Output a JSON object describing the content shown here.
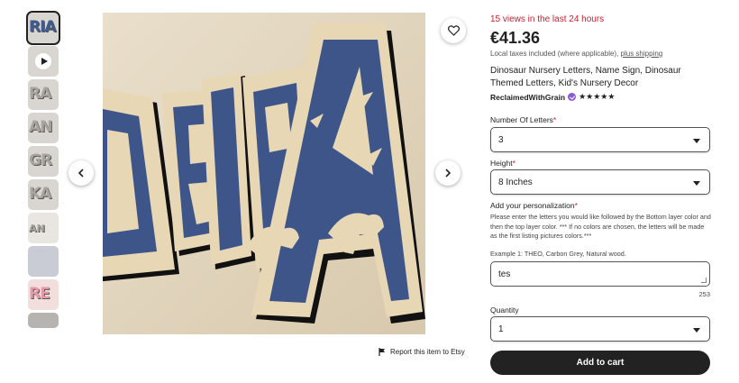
{
  "thumbnails": [
    {
      "text": "RIA",
      "type": "image"
    },
    {
      "text": "",
      "type": "video"
    },
    {
      "text": "RA",
      "type": "image"
    },
    {
      "text": "AN",
      "type": "image"
    },
    {
      "text": "GR",
      "type": "image"
    },
    {
      "text": "KA",
      "type": "image"
    },
    {
      "text": "AN",
      "type": "image"
    },
    {
      "text": "",
      "type": "image"
    },
    {
      "text": "RE",
      "type": "image"
    },
    {
      "text": "",
      "type": "image"
    }
  ],
  "main_image": {
    "alt": "Dinosaur nursery letters RIA in wood and blue",
    "visible_letters": "ORIA"
  },
  "icons": {
    "prev": "chevron-left-icon",
    "next": "chevron-right-icon",
    "favorite": "heart-icon",
    "report": "flag-icon",
    "caret": "chevron-down-icon"
  },
  "report_label": "Report this item to Etsy",
  "listing": {
    "views": "15 views in the last 24 hours",
    "price": "€41.36",
    "tax_note": "Local taxes included (where applicable), ",
    "shipping_link": "plus shipping",
    "title": "Dinosaur Nursery Letters, Name Sign, Dinosaur Themed Letters, Kid's Nursery Decor",
    "seller": "ReclaimedWithGrain",
    "rating_stars": "★★★★★",
    "rating_value": 5
  },
  "form": {
    "letters_label": "Number Of Letters",
    "letters_value": "3",
    "height_label": "Height",
    "height_value": "8 Inches",
    "personalization_label": "Add your personalization",
    "required_mark": "*",
    "instructions": "Please enter the letters you would like followed by the Bottom layer color and then the top layer color. *** If no colors are chosen, the letters will be made as the first listing pictures colors.***",
    "example": "Example 1: THEO, Carbon Grey, Natural wood.",
    "personalization_value": "tes",
    "char_count": "253",
    "quantity_label": "Quantity",
    "quantity_value": "1",
    "add_to_cart": "Add to cart"
  },
  "colors": {
    "urgency_red": "#c71e32",
    "button_dark": "#222222",
    "wood": "#e8d7b5",
    "letter_blue": "#3d5589"
  }
}
